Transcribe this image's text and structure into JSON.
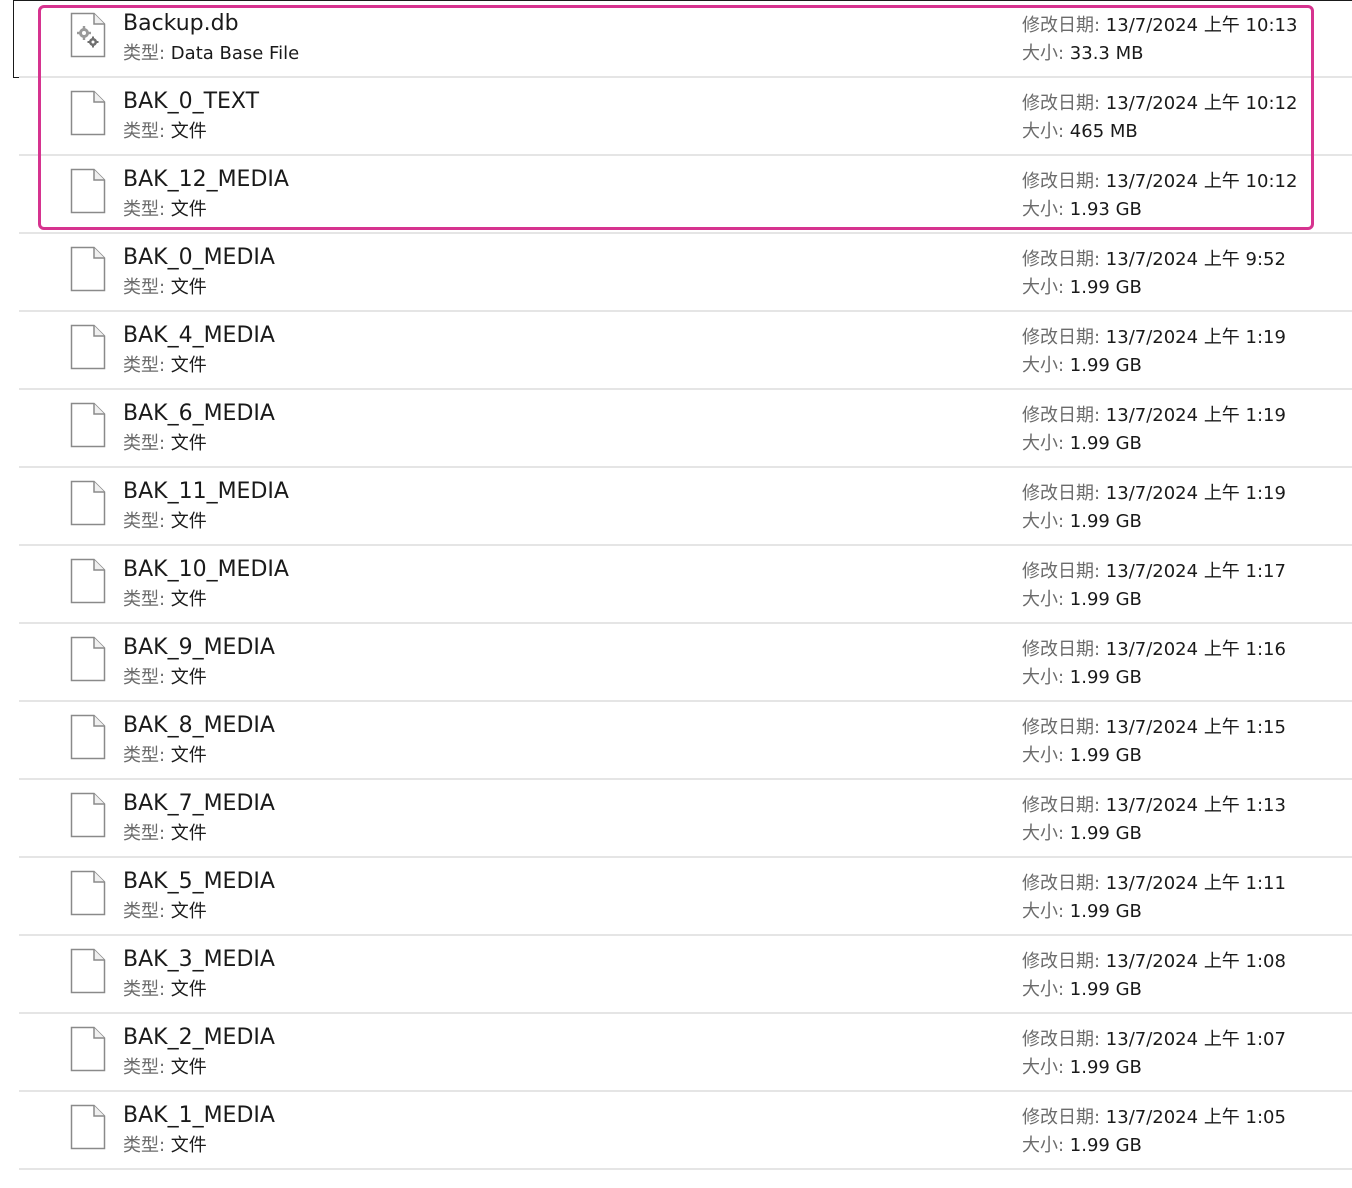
{
  "labels": {
    "type": "类型: ",
    "modified": "修改日期: ",
    "size": "大小: "
  },
  "files": [
    {
      "name": "Backup.db",
      "type": "Data Base File",
      "modified": "13/7/2024 上午 10:13",
      "size": "33.3 MB",
      "icon": "database-file-icon",
      "selected": true
    },
    {
      "name": "BAK_0_TEXT",
      "type": "文件",
      "modified": "13/7/2024 上午 10:12",
      "size": "465 MB",
      "icon": "blank-file-icon",
      "selected": false
    },
    {
      "name": "BAK_12_MEDIA",
      "type": "文件",
      "modified": "13/7/2024 上午 10:12",
      "size": "1.93 GB",
      "icon": "blank-file-icon",
      "selected": false
    },
    {
      "name": "BAK_0_MEDIA",
      "type": "文件",
      "modified": "13/7/2024 上午 9:52",
      "size": "1.99 GB",
      "icon": "blank-file-icon",
      "selected": false
    },
    {
      "name": "BAK_4_MEDIA",
      "type": "文件",
      "modified": "13/7/2024 上午 1:19",
      "size": "1.99 GB",
      "icon": "blank-file-icon",
      "selected": false
    },
    {
      "name": "BAK_6_MEDIA",
      "type": "文件",
      "modified": "13/7/2024 上午 1:19",
      "size": "1.99 GB",
      "icon": "blank-file-icon",
      "selected": false
    },
    {
      "name": "BAK_11_MEDIA",
      "type": "文件",
      "modified": "13/7/2024 上午 1:19",
      "size": "1.99 GB",
      "icon": "blank-file-icon",
      "selected": false
    },
    {
      "name": "BAK_10_MEDIA",
      "type": "文件",
      "modified": "13/7/2024 上午 1:17",
      "size": "1.99 GB",
      "icon": "blank-file-icon",
      "selected": false
    },
    {
      "name": "BAK_9_MEDIA",
      "type": "文件",
      "modified": "13/7/2024 上午 1:16",
      "size": "1.99 GB",
      "icon": "blank-file-icon",
      "selected": false
    },
    {
      "name": "BAK_8_MEDIA",
      "type": "文件",
      "modified": "13/7/2024 上午 1:15",
      "size": "1.99 GB",
      "icon": "blank-file-icon",
      "selected": false
    },
    {
      "name": "BAK_7_MEDIA",
      "type": "文件",
      "modified": "13/7/2024 上午 1:13",
      "size": "1.99 GB",
      "icon": "blank-file-icon",
      "selected": false
    },
    {
      "name": "BAK_5_MEDIA",
      "type": "文件",
      "modified": "13/7/2024 上午 1:11",
      "size": "1.99 GB",
      "icon": "blank-file-icon",
      "selected": false
    },
    {
      "name": "BAK_3_MEDIA",
      "type": "文件",
      "modified": "13/7/2024 上午 1:08",
      "size": "1.99 GB",
      "icon": "blank-file-icon",
      "selected": false
    },
    {
      "name": "BAK_2_MEDIA",
      "type": "文件",
      "modified": "13/7/2024 上午 1:07",
      "size": "1.99 GB",
      "icon": "blank-file-icon",
      "selected": false
    },
    {
      "name": "BAK_1_MEDIA",
      "type": "文件",
      "modified": "13/7/2024 上午 1:05",
      "size": "1.99 GB",
      "icon": "blank-file-icon",
      "selected": false
    }
  ],
  "colors": {
    "highlight": "#d6338f",
    "separator": "#e5e5e5",
    "label": "#6b6b6b",
    "text": "#1a1a1a"
  }
}
